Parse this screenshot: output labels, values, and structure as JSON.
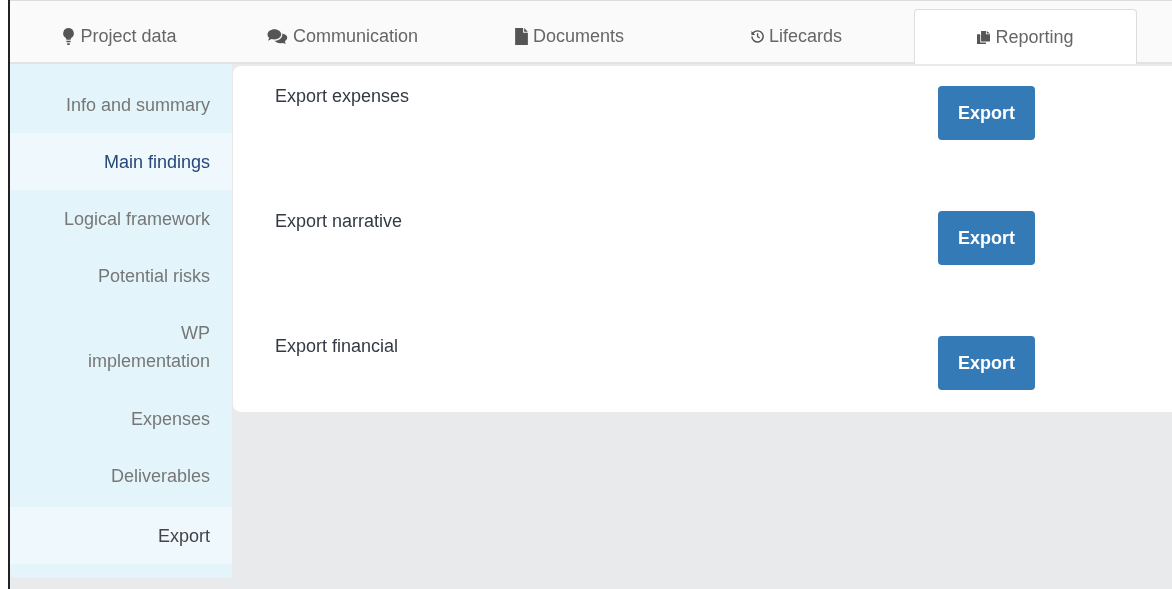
{
  "tabs": [
    {
      "label": "Project data",
      "selected": false
    },
    {
      "label": "Communication",
      "selected": false
    },
    {
      "label": "Documents",
      "selected": false
    },
    {
      "label": "Lifecards",
      "selected": false
    },
    {
      "label": "Reporting",
      "selected": true
    }
  ],
  "sidebar": {
    "items": [
      {
        "label": "Info and summary",
        "selected": false,
        "hovered": false
      },
      {
        "label": "Main findings",
        "selected": true,
        "hovered": false
      },
      {
        "label": "Logical framework",
        "selected": false,
        "hovered": false
      },
      {
        "label": "Potential risks",
        "selected": false,
        "hovered": false
      },
      {
        "label": "WP\nimplementation",
        "selected": false,
        "hovered": false
      },
      {
        "label": "Expenses",
        "selected": false,
        "hovered": false
      },
      {
        "label": "Deliverables",
        "selected": false,
        "hovered": false
      },
      {
        "label": "Export",
        "selected": false,
        "hovered": true
      }
    ]
  },
  "exports": [
    {
      "title": "Export expenses",
      "button": "Export"
    },
    {
      "title": "Export narrative",
      "button": "Export"
    },
    {
      "title": "Export financial",
      "button": "Export"
    }
  ]
}
